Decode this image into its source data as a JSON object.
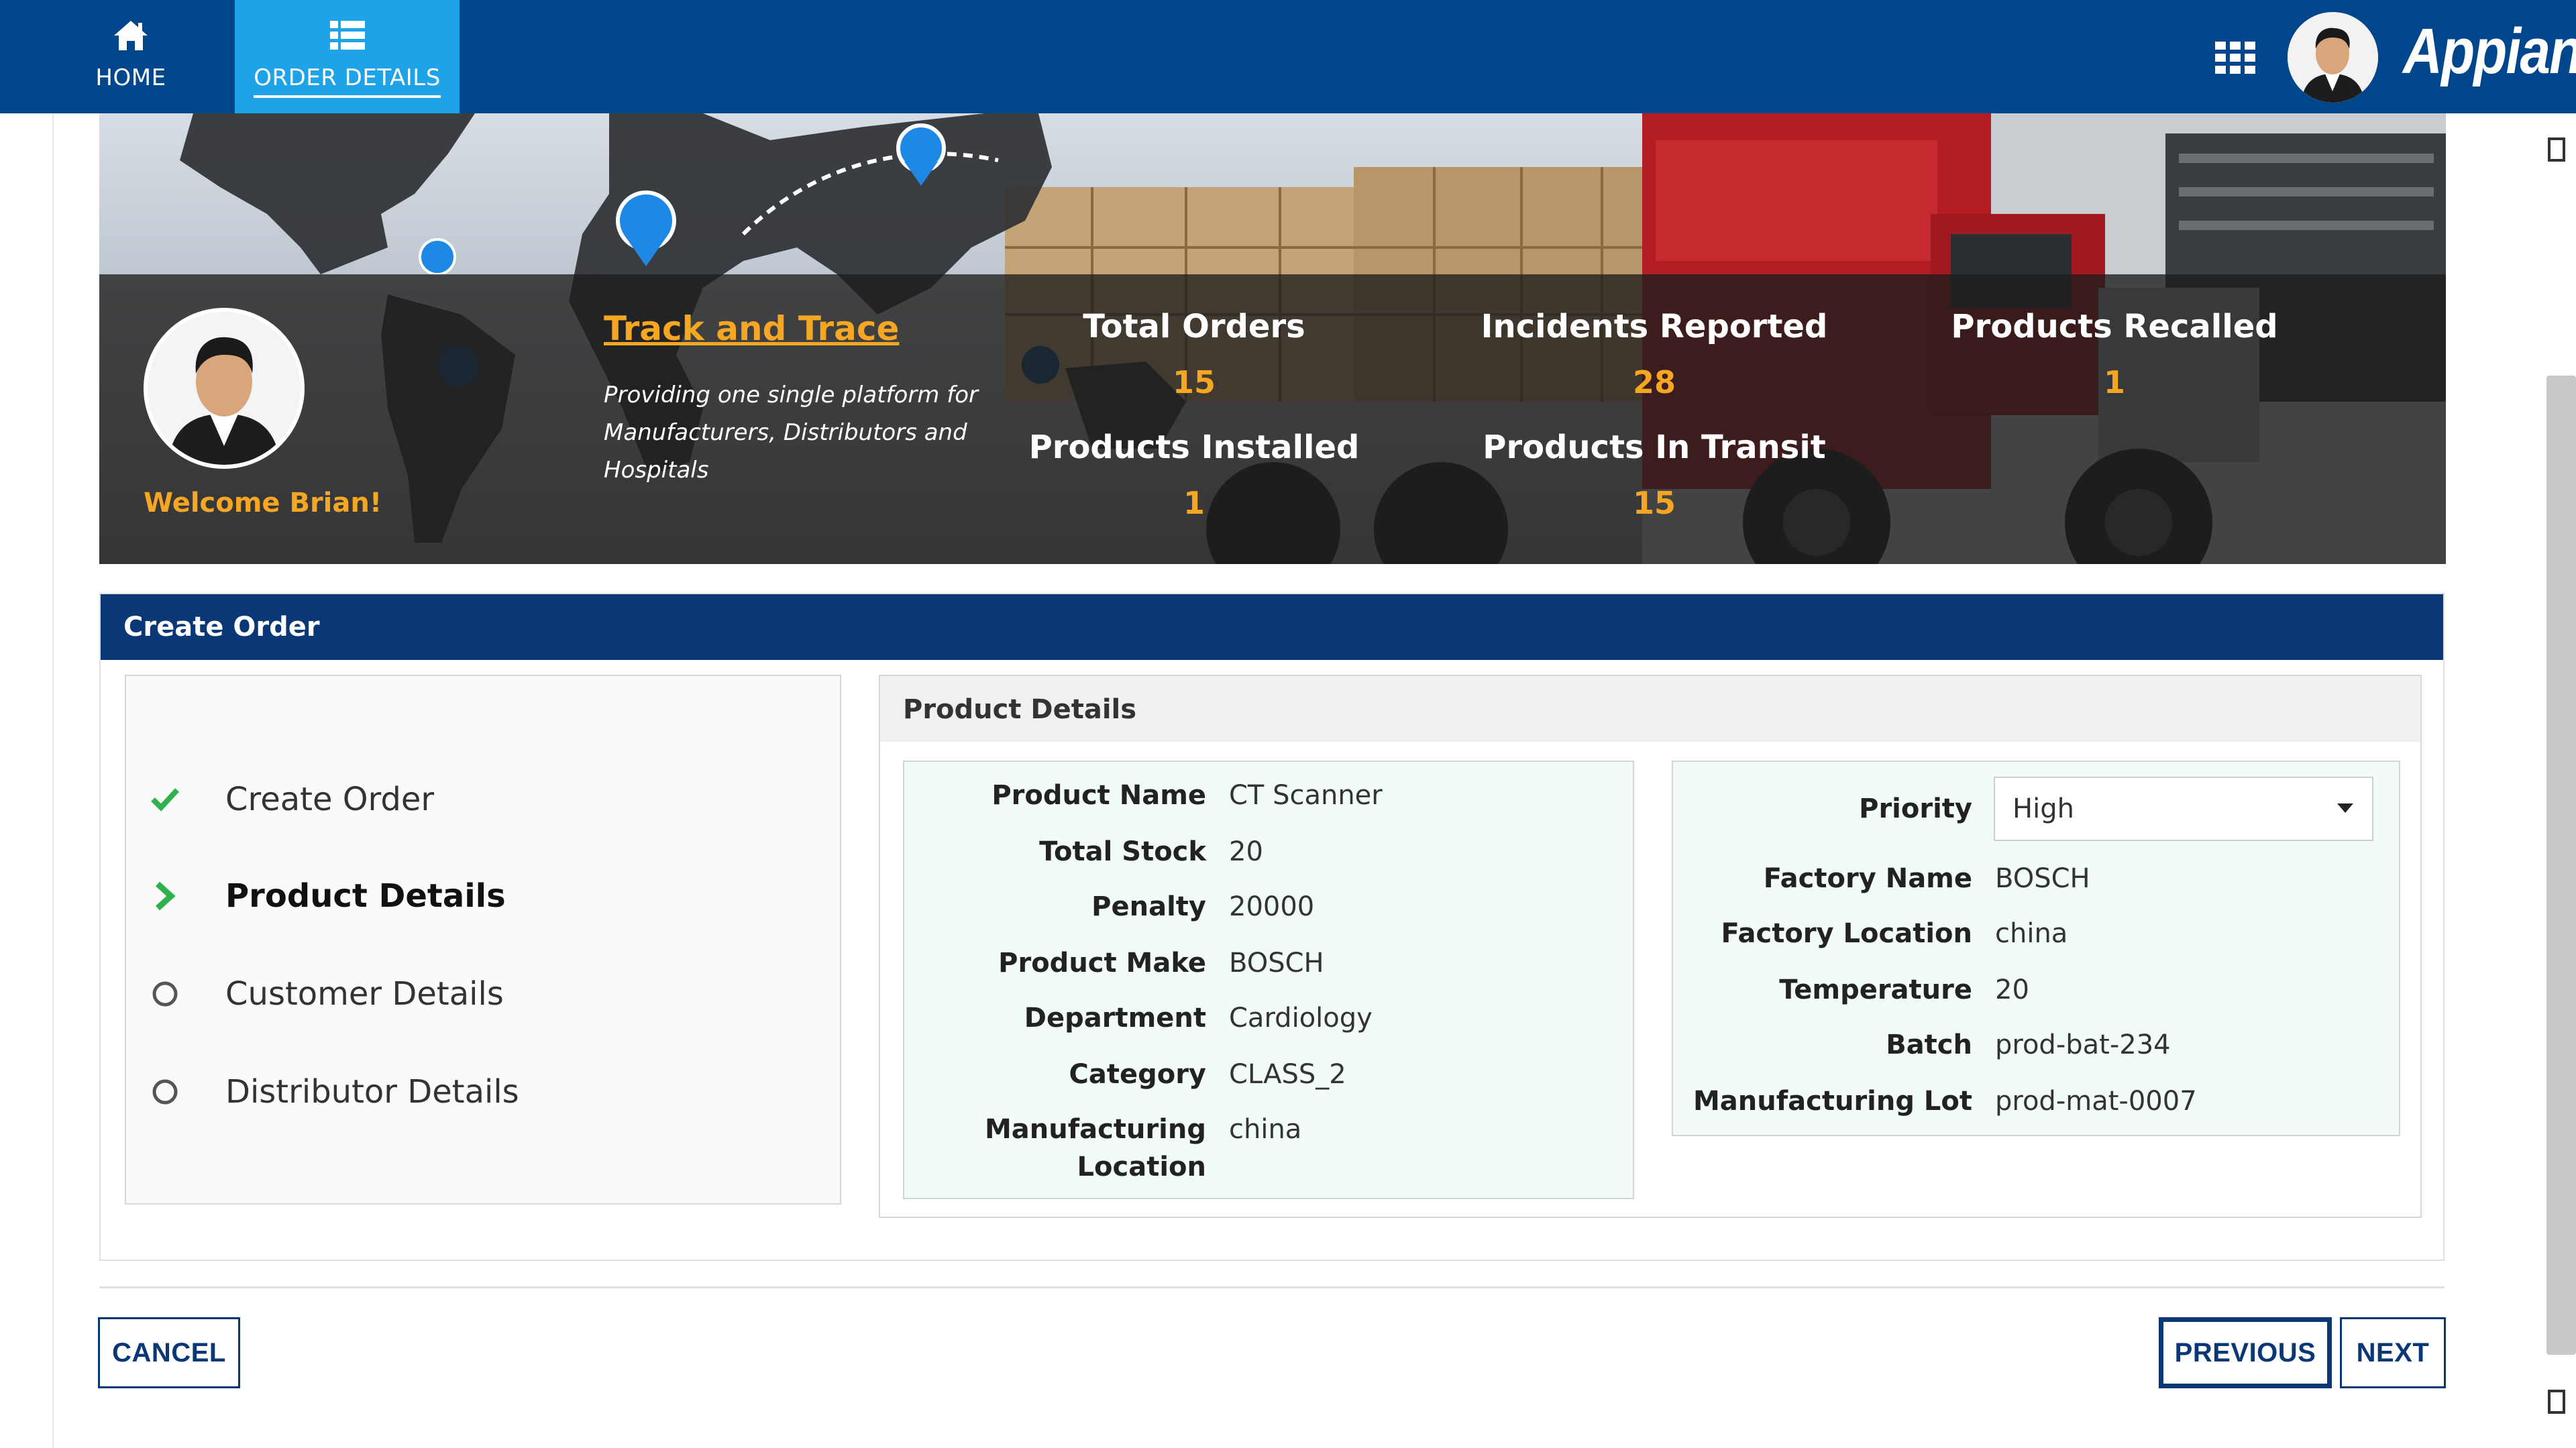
{
  "nav": {
    "home_label": "HOME",
    "order_details_label": "ORDER DETAILS",
    "brand": "Appian"
  },
  "hero": {
    "welcome": "Welcome Brian!",
    "track_title": "Track and Trace",
    "track_desc": "Providing one single platform for Manufacturers, Distributors and Hospitals",
    "stats": [
      {
        "label": "Total Orders",
        "value": "15"
      },
      {
        "label": "Incidents Reported",
        "value": "28"
      },
      {
        "label": "Products Recalled",
        "value": "1"
      },
      {
        "label": "Products Installed",
        "value": "1"
      },
      {
        "label": "Products In Transit",
        "value": "15"
      }
    ]
  },
  "panel": {
    "title": "Create Order",
    "steps": [
      {
        "label": "Create Order",
        "state": "done"
      },
      {
        "label": "Product Details",
        "state": "active"
      },
      {
        "label": "Customer Details",
        "state": "pending"
      },
      {
        "label": "Distributor Details",
        "state": "pending"
      }
    ],
    "details_title": "Product Details",
    "left_fields": [
      {
        "label": "Product Name",
        "value": "CT Scanner"
      },
      {
        "label": "Total Stock",
        "value": "20"
      },
      {
        "label": "Penalty",
        "value": "20000"
      },
      {
        "label": "Product Make",
        "value": "BOSCH"
      },
      {
        "label": "Department",
        "value": "Cardiology"
      },
      {
        "label": "Category",
        "value": "CLASS_2"
      },
      {
        "label": "Manufacturing Location",
        "label_line1": "Manufacturing",
        "label_line2": "Location",
        "value": "china"
      }
    ],
    "priority": {
      "label": "Priority",
      "value": "High"
    },
    "right_fields": [
      {
        "label": "Factory Name",
        "value": "BOSCH"
      },
      {
        "label": "Factory Location",
        "value": "china"
      },
      {
        "label": "Temperature",
        "value": "20"
      },
      {
        "label": "Batch",
        "value": "prod-bat-234"
      },
      {
        "label": "Manufacturing Lot",
        "value": "prod-mat-0007"
      }
    ]
  },
  "buttons": {
    "cancel": "CANCEL",
    "previous": "PREVIOUS",
    "next": "NEXT"
  },
  "colors": {
    "nav_bg": "#00468c",
    "nav_active": "#1fa3e8",
    "accent_orange": "#f5a623",
    "panel_header": "#0a3877",
    "check_green": "#2db34a"
  }
}
